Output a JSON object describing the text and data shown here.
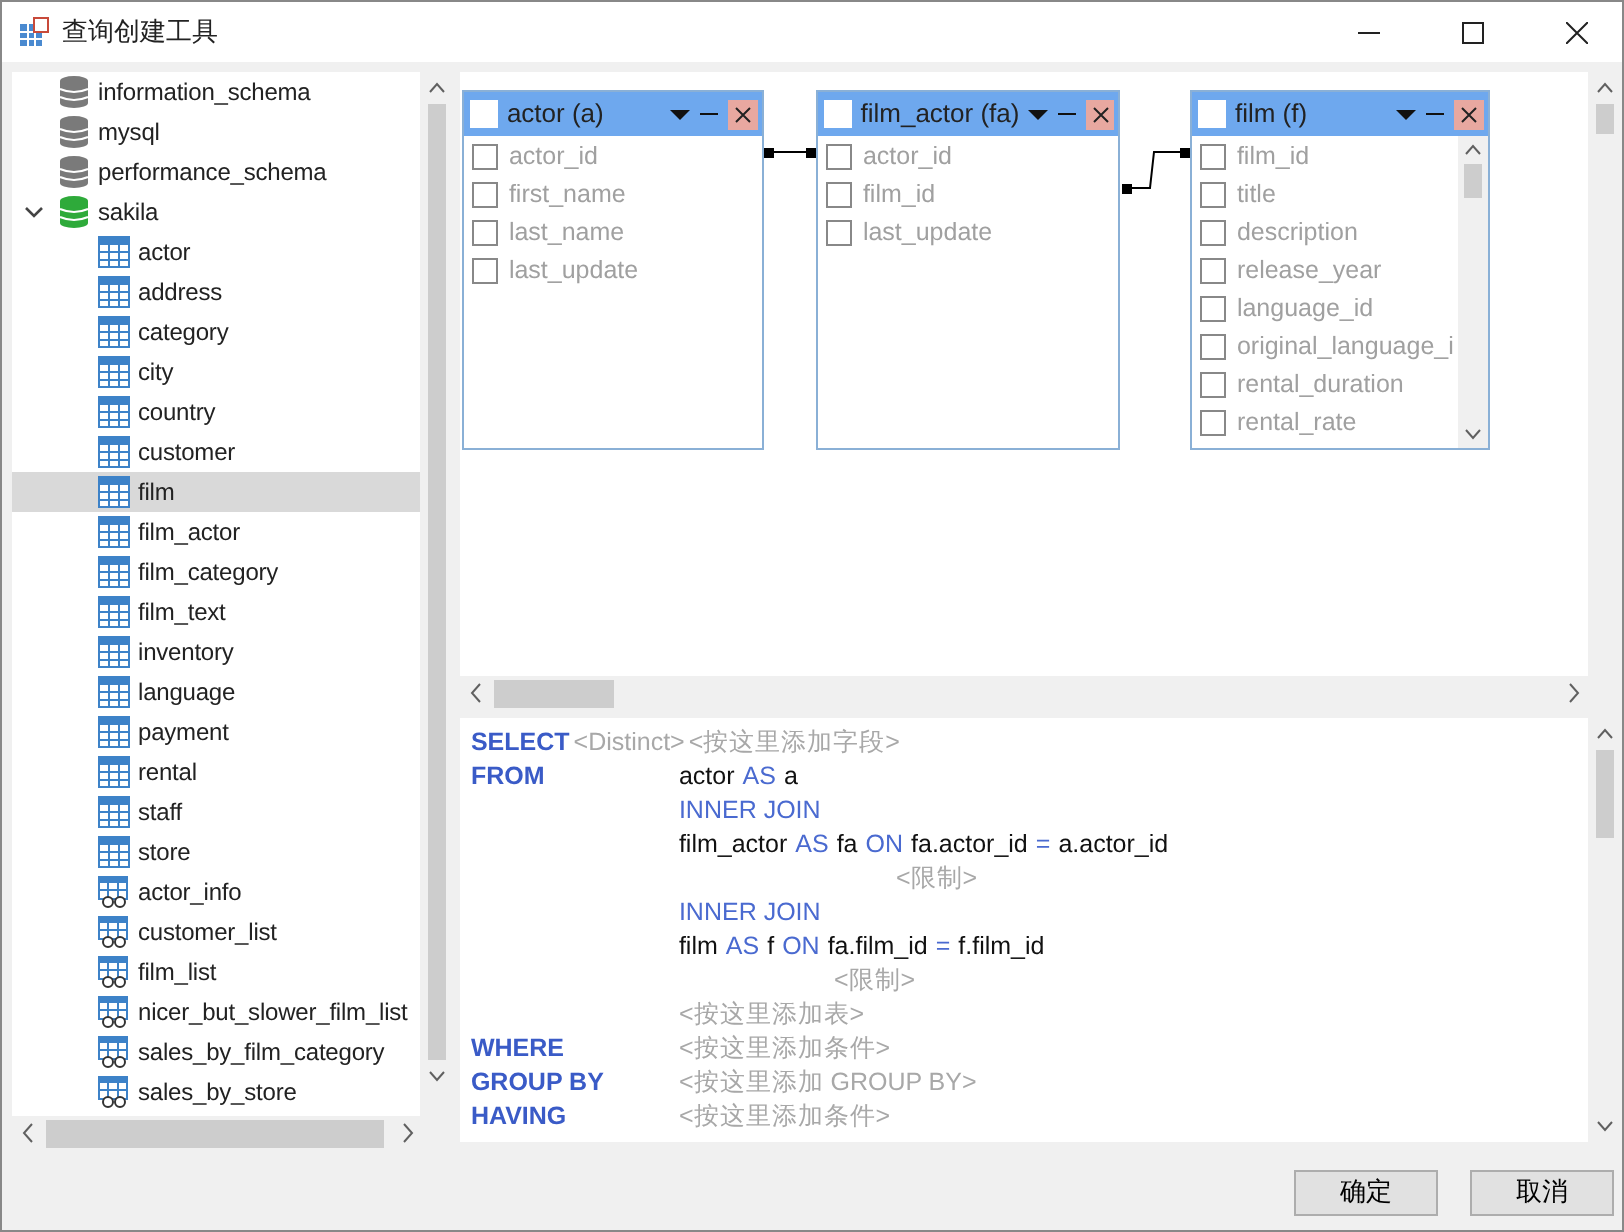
{
  "window": {
    "title": "查询创建工具"
  },
  "tree": [
    {
      "label": "information_schema",
      "kind": "database",
      "connected": false,
      "expanded": false,
      "selected": false
    },
    {
      "label": "mysql",
      "kind": "database",
      "connected": false,
      "expanded": false,
      "selected": false
    },
    {
      "label": "performance_schema",
      "kind": "database",
      "connected": false,
      "expanded": false,
      "selected": false
    },
    {
      "label": "sakila",
      "kind": "database",
      "connected": true,
      "expanded": true,
      "selected": false,
      "children": [
        {
          "label": "actor",
          "kind": "table",
          "selected": false
        },
        {
          "label": "address",
          "kind": "table",
          "selected": false
        },
        {
          "label": "category",
          "kind": "table",
          "selected": false
        },
        {
          "label": "city",
          "kind": "table",
          "selected": false
        },
        {
          "label": "country",
          "kind": "table",
          "selected": false
        },
        {
          "label": "customer",
          "kind": "table",
          "selected": false
        },
        {
          "label": "film",
          "kind": "table",
          "selected": true
        },
        {
          "label": "film_actor",
          "kind": "table",
          "selected": false
        },
        {
          "label": "film_category",
          "kind": "table",
          "selected": false
        },
        {
          "label": "film_text",
          "kind": "table",
          "selected": false
        },
        {
          "label": "inventory",
          "kind": "table",
          "selected": false
        },
        {
          "label": "language",
          "kind": "table",
          "selected": false
        },
        {
          "label": "payment",
          "kind": "table",
          "selected": false
        },
        {
          "label": "rental",
          "kind": "table",
          "selected": false
        },
        {
          "label": "staff",
          "kind": "table",
          "selected": false
        },
        {
          "label": "store",
          "kind": "table",
          "selected": false
        },
        {
          "label": "actor_info",
          "kind": "view",
          "selected": false
        },
        {
          "label": "customer_list",
          "kind": "view",
          "selected": false
        },
        {
          "label": "film_list",
          "kind": "view",
          "selected": false
        },
        {
          "label": "nicer_but_slower_film_list",
          "kind": "view",
          "selected": false
        },
        {
          "label": "sales_by_film_category",
          "kind": "view",
          "selected": false
        },
        {
          "label": "sales_by_store",
          "kind": "view",
          "selected": false
        }
      ]
    }
  ],
  "diagram_tables": [
    {
      "title": "actor (a)",
      "checked": false,
      "scrollable": false,
      "fields": [
        {
          "name": "actor_id",
          "checked": false
        },
        {
          "name": "first_name",
          "checked": false
        },
        {
          "name": "last_name",
          "checked": false
        },
        {
          "name": "last_update",
          "checked": false
        }
      ]
    },
    {
      "title": "film_actor (fa)",
      "checked": false,
      "scrollable": false,
      "fields": [
        {
          "name": "actor_id",
          "checked": false
        },
        {
          "name": "film_id",
          "checked": false
        },
        {
          "name": "last_update",
          "checked": false
        }
      ]
    },
    {
      "title": "film (f)",
      "checked": false,
      "scrollable": true,
      "fields": [
        {
          "name": "film_id",
          "checked": false
        },
        {
          "name": "title",
          "checked": false
        },
        {
          "name": "description",
          "checked": false
        },
        {
          "name": "release_year",
          "checked": false
        },
        {
          "name": "language_id",
          "checked": false
        },
        {
          "name": "original_language_i",
          "checked": false
        },
        {
          "name": "rental_duration",
          "checked": false
        },
        {
          "name": "rental_rate",
          "checked": false
        }
      ]
    }
  ],
  "sql_lines": [
    {
      "kind": "select",
      "clause": "SELECT",
      "tokens": [
        {
          "kind": "hint",
          "text": "<Distinct>"
        },
        {
          "kind": "hint",
          "text": "<按这里添加字段>"
        }
      ]
    },
    {
      "kind": "clause",
      "clause": "FROM",
      "tokens": [
        {
          "kind": "text",
          "text": "actor"
        },
        {
          "kind": "keyword",
          "text": "AS"
        },
        {
          "kind": "text",
          "text": "a"
        }
      ]
    },
    {
      "kind": "body",
      "tokens": [
        {
          "kind": "keyword",
          "text": "INNER JOIN"
        }
      ]
    },
    {
      "kind": "body",
      "tokens": [
        {
          "kind": "text",
          "text": "film_actor"
        },
        {
          "kind": "keyword",
          "text": "AS"
        },
        {
          "kind": "text",
          "text": "fa"
        },
        {
          "kind": "keyword",
          "text": "ON"
        },
        {
          "kind": "text",
          "text": "fa.actor_id"
        },
        {
          "kind": "keyword",
          "text": "="
        },
        {
          "kind": "text",
          "text": "a.actor_id"
        }
      ]
    },
    {
      "kind": "limit",
      "tokens": [
        {
          "kind": "hint",
          "text": "<限制>"
        }
      ]
    },
    {
      "kind": "body",
      "tokens": [
        {
          "kind": "keyword",
          "text": "INNER JOIN"
        }
      ]
    },
    {
      "kind": "body",
      "tokens": [
        {
          "kind": "text",
          "text": "film"
        },
        {
          "kind": "keyword",
          "text": "AS"
        },
        {
          "kind": "text",
          "text": "f"
        },
        {
          "kind": "keyword",
          "text": "ON"
        },
        {
          "kind": "text",
          "text": "fa.film_id"
        },
        {
          "kind": "keyword",
          "text": "="
        },
        {
          "kind": "text",
          "text": "f.film_id"
        }
      ]
    },
    {
      "kind": "limit",
      "tokens": [
        {
          "kind": "hint",
          "text": "<限制>"
        }
      ]
    },
    {
      "kind": "body",
      "tokens": [
        {
          "kind": "hint",
          "text": "<按这里添加表>"
        }
      ]
    },
    {
      "kind": "clause",
      "clause": "WHERE",
      "tokens": [
        {
          "kind": "hint",
          "text": "<按这里添加条件>"
        }
      ]
    },
    {
      "kind": "clause",
      "clause": "GROUP BY",
      "tokens": [
        {
          "kind": "hint",
          "text": "<按这里添加 GROUP BY>"
        }
      ]
    },
    {
      "kind": "clause",
      "clause": "HAVING",
      "tokens": [
        {
          "kind": "hint",
          "text": "<按这里添加条件>"
        }
      ]
    }
  ],
  "buttons": [
    {
      "label": "确定"
    },
    {
      "label": "取消"
    }
  ]
}
